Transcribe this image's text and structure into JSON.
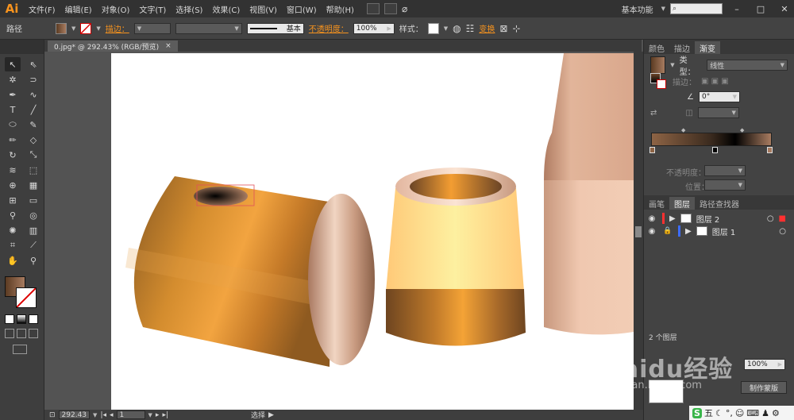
{
  "app": {
    "logo": "Ai",
    "menus": [
      "文件(F)",
      "编辑(E)",
      "对象(O)",
      "文字(T)",
      "选择(S)",
      "效果(C)",
      "视图(V)",
      "窗口(W)",
      "帮助(H)"
    ],
    "workspace": "基本功能",
    "window_controls": [
      "–",
      "□",
      "✕"
    ]
  },
  "control_bar": {
    "object_type": "路径",
    "stroke_label": "描边：",
    "stroke_style": "基本",
    "opacity_label": "不透明度：",
    "opacity_value": "100%",
    "style_label": "样式：",
    "transform_label": "变换"
  },
  "document": {
    "tab_title": "0.jpg* @ 292.43% (RGB/预览)",
    "tab_close": "×"
  },
  "status_bar": {
    "zoom": "292.43",
    "page": "1",
    "tool_status": "选择"
  },
  "gradient_panel": {
    "tabs": [
      "颜色",
      "描边",
      "渐变"
    ],
    "active_tab": "渐变",
    "type_label": "类型：",
    "type_value": "线性",
    "stroke_label": "描边：",
    "angle_value": "0°",
    "opacity_label": "不透明度：",
    "position_label": "位置：",
    "colors": {
      "dark_brown": "#8e6445",
      "black": "#000000",
      "light_brown": "#a77b60"
    }
  },
  "layers_panel": {
    "tabs": [
      "画笔",
      "图层",
      "路径查找器"
    ],
    "active_tab": "图层",
    "layers": [
      {
        "name": "图层 2",
        "color": "#ff3030"
      },
      {
        "name": "图层 1",
        "color": "#3d6cff"
      }
    ],
    "layer_count": "2 个图层"
  },
  "bottom_panel": {
    "opacity_value": "100%",
    "make_mask_button": "制作蒙版"
  },
  "watermark": {
    "text": "Baidu经验",
    "url": "jingyan.baidu.com"
  },
  "tray": {
    "ime": "五"
  }
}
